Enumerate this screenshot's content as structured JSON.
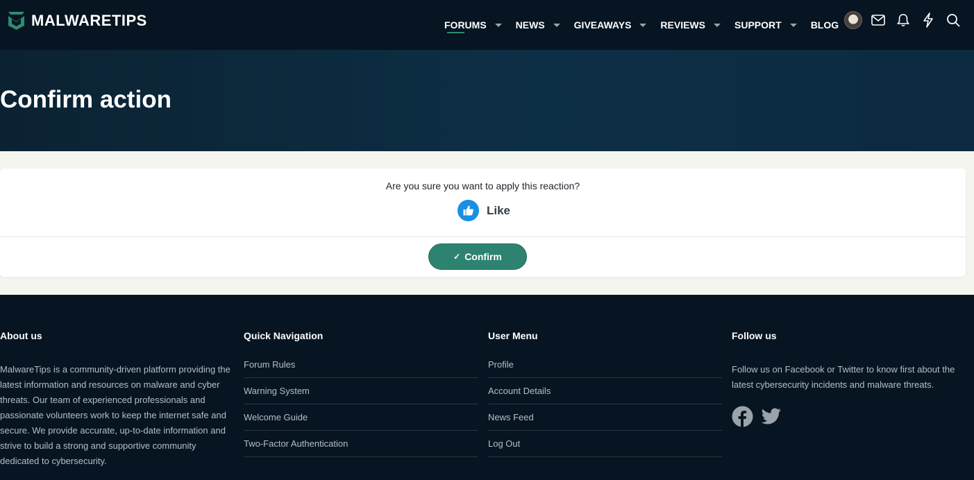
{
  "header": {
    "brand": "MALWARETIPS",
    "nav": [
      {
        "label": "FORUMS",
        "has_dropdown": true,
        "active": true
      },
      {
        "label": "NEWS",
        "has_dropdown": true,
        "active": false
      },
      {
        "label": "GIVEAWAYS",
        "has_dropdown": true,
        "active": false
      },
      {
        "label": "REVIEWS",
        "has_dropdown": true,
        "active": false
      },
      {
        "label": "SUPPORT",
        "has_dropdown": true,
        "active": false
      },
      {
        "label": "BLOG",
        "has_dropdown": false,
        "active": false
      }
    ],
    "icons": [
      "avatar",
      "envelope-icon",
      "bell-icon",
      "lightning-icon",
      "search-icon"
    ]
  },
  "page": {
    "title": "Confirm action"
  },
  "dialog": {
    "question": "Are you sure you want to apply this reaction?",
    "reaction_label": "Like",
    "reaction_icon": "thumbs-up-icon",
    "confirm_label": "Confirm"
  },
  "footer": {
    "about": {
      "title": "About us",
      "text": "MalwareTips is a community-driven platform providing the latest information and resources on malware and cyber threats. Our team of experienced professionals and passionate volunteers work to keep the internet safe and secure. We provide accurate, up-to-date information and strive to build a strong and supportive community dedicated to cybersecurity."
    },
    "quick_nav": {
      "title": "Quick Navigation",
      "links": [
        "Forum Rules",
        "Warning System",
        "Welcome Guide",
        "Two-Factor Authentication"
      ]
    },
    "user_menu": {
      "title": "User Menu",
      "links": [
        "Profile",
        "Account Details",
        "News Feed",
        "Log Out"
      ]
    },
    "follow": {
      "title": "Follow us",
      "text": "Follow us on Facebook or Twitter to know first about the latest cybersecurity incidents and malware threats.",
      "icons": [
        "facebook-icon",
        "twitter-icon"
      ]
    }
  },
  "colors": {
    "header_bg": "#071522",
    "accent": "#2e8370",
    "like_blue": "#1a8fe3"
  }
}
